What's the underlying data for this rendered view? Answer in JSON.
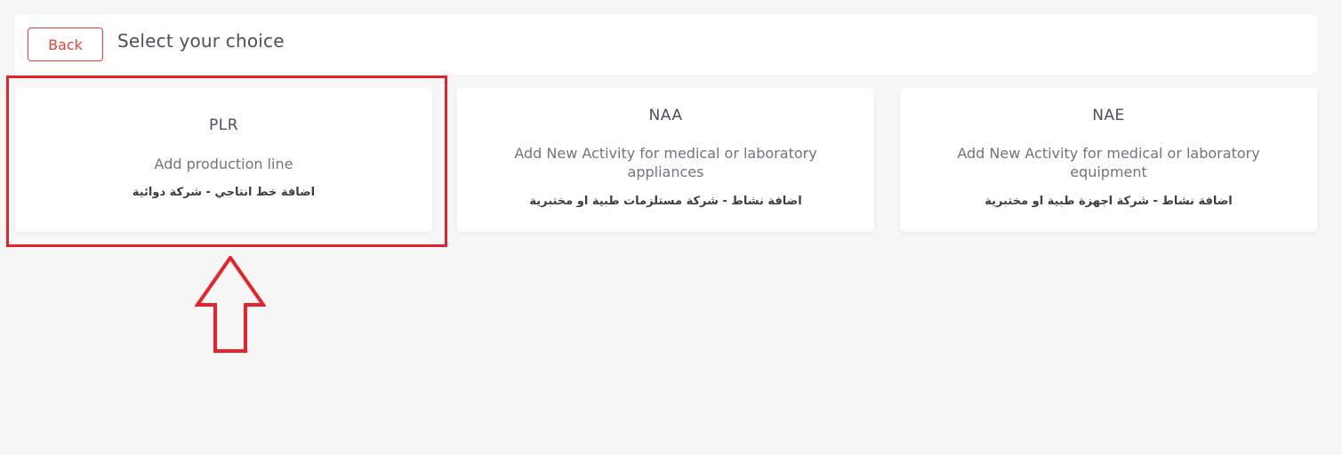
{
  "header": {
    "back_label": "Back",
    "title": "Select your choice"
  },
  "cards": [
    {
      "code": "PLR",
      "description": "Add production line",
      "arabic": "اضافة خط انتاجي - شركة دوائية"
    },
    {
      "code": "NAA",
      "description": "Add New Activity for medical or laboratory appliances",
      "arabic": "اضافة نشاط - شركة مستلزمات طبية او مختبرية"
    },
    {
      "code": "NAE",
      "description": "Add New Activity for medical or laboratory equipment",
      "arabic": "اضافة نشاط - شركة اجهزة طبية او مختبرية"
    }
  ],
  "annotation": {
    "highlight_color": "#e8222a",
    "arrow_icon": "up-arrow-icon"
  },
  "colors": {
    "accent": "#e53e3e",
    "background": "#f7f7f7",
    "card": "#ffffff",
    "title_text": "#4d4d63"
  }
}
